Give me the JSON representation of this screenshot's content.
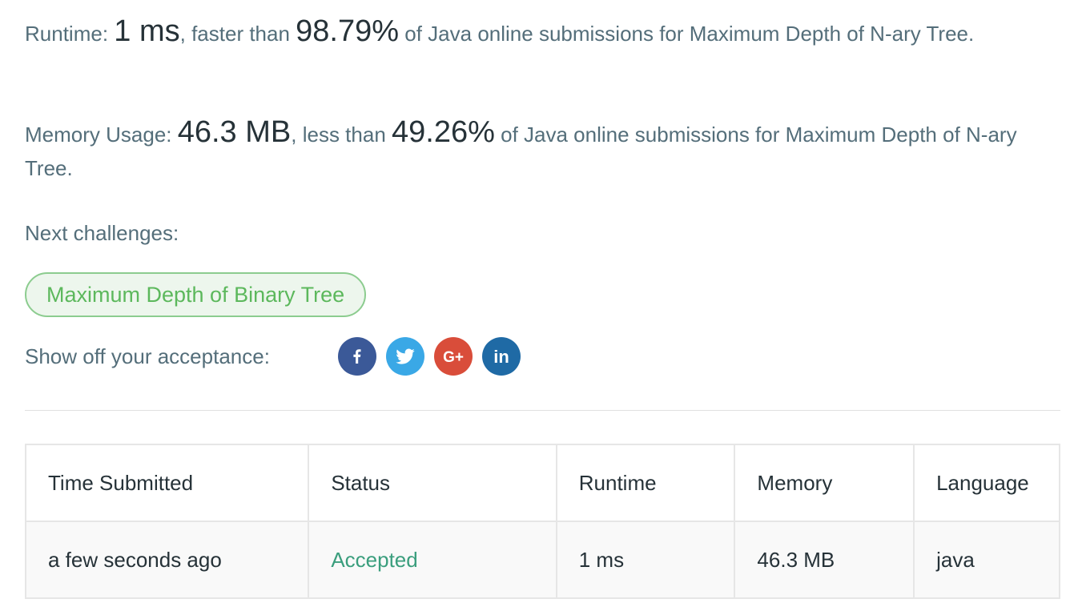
{
  "runtime": {
    "label": "Runtime: ",
    "value": "1 ms",
    "mid": ", faster than ",
    "percent": "98.79%",
    "tail": " of Java online submissions for Maximum Depth of N-ary Tree."
  },
  "memory": {
    "label": "Memory Usage: ",
    "value": "46.3 MB",
    "mid": ", less than ",
    "percent": "49.26%",
    "tail": " of Java online submissions for Maximum Depth of N-ary Tree."
  },
  "next_challenges": {
    "label": "Next challenges:",
    "items": [
      "Maximum Depth of Binary Tree"
    ],
    "pill_color": "#5cb85c"
  },
  "share": {
    "label": "Show off your acceptance:",
    "buttons": [
      {
        "icon": "facebook-icon",
        "color": "#3b5998"
      },
      {
        "icon": "twitter-icon",
        "color": "#3aa8e6"
      },
      {
        "icon": "google-plus-icon",
        "color": "#d94d3a",
        "glyph": "G+"
      },
      {
        "icon": "linkedin-icon",
        "color": "#1f6aa5",
        "glyph": "in"
      }
    ]
  },
  "table": {
    "headers": [
      "Time Submitted",
      "Status",
      "Runtime",
      "Memory",
      "Language"
    ],
    "rows": [
      [
        "a few seconds ago",
        "Accepted",
        "1 ms",
        "46.3 MB",
        "java"
      ]
    ],
    "status_color": "#3a9e7d"
  }
}
